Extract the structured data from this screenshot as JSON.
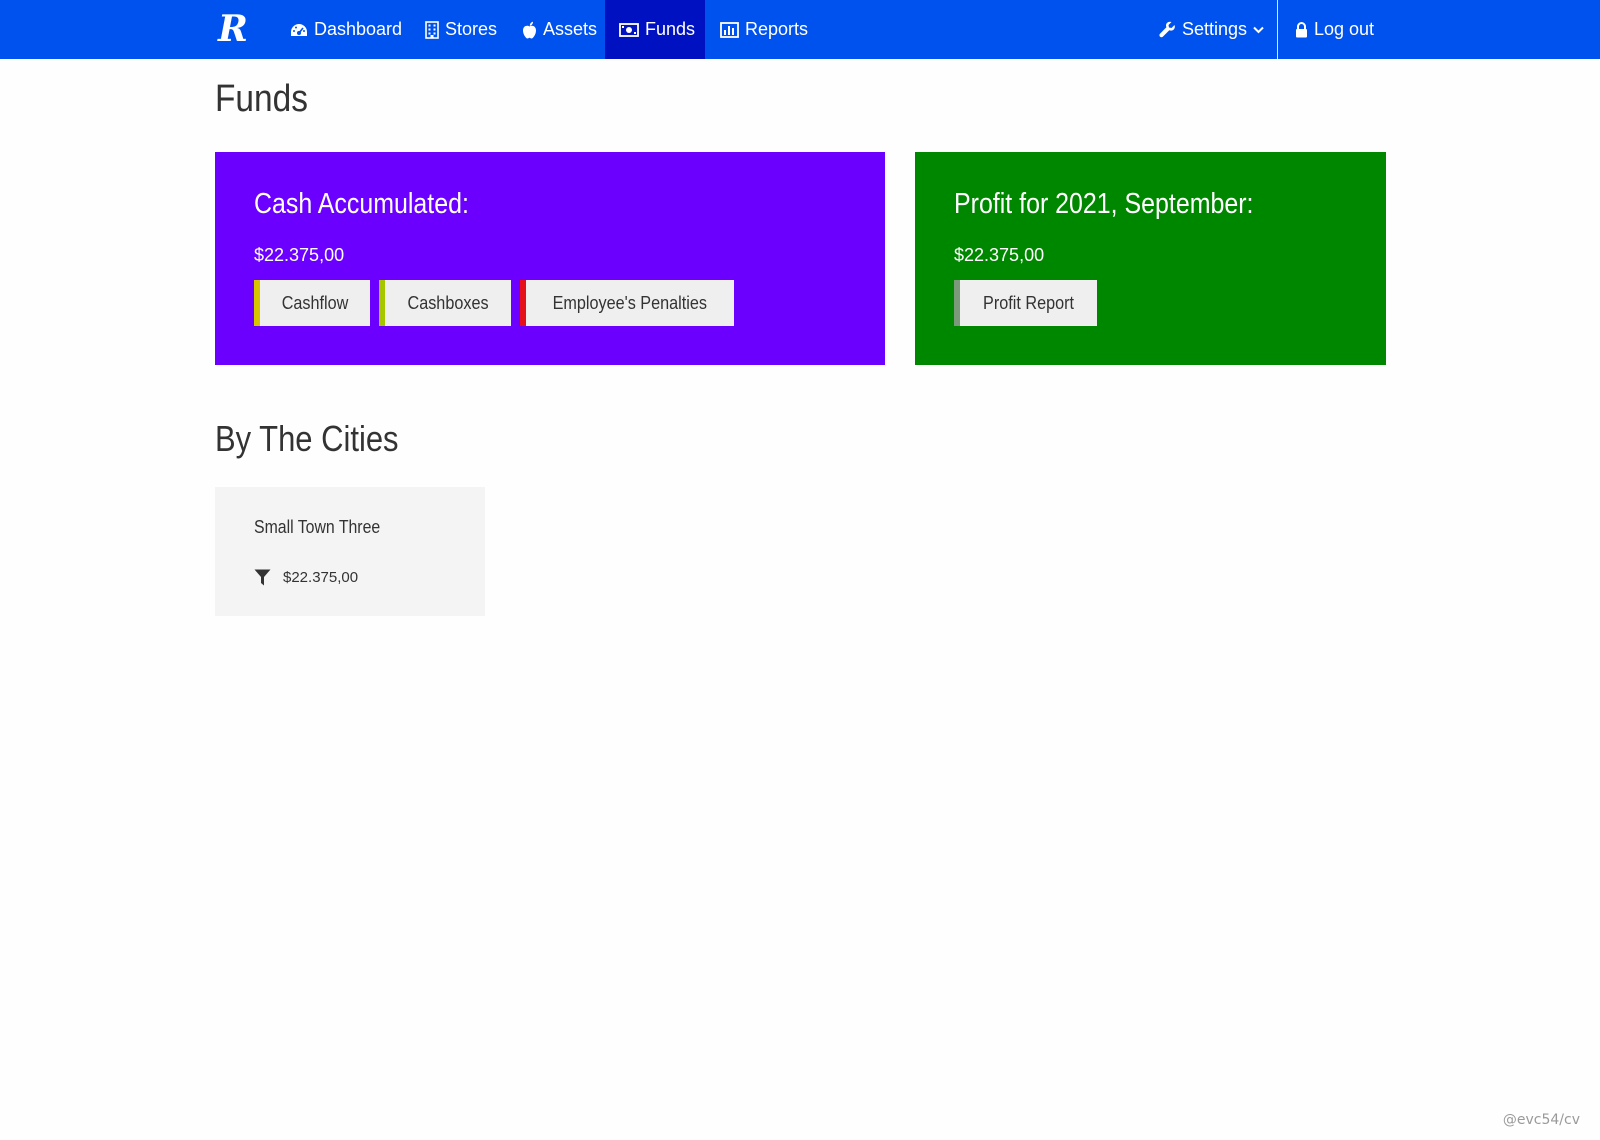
{
  "navbar": {
    "brand": "R",
    "items": [
      {
        "label": "Dashboard",
        "icon": "tachometer-icon",
        "active": false
      },
      {
        "label": "Stores",
        "icon": "building-icon",
        "active": false
      },
      {
        "label": "Assets",
        "icon": "apple-icon",
        "active": false
      },
      {
        "label": "Funds",
        "icon": "money-icon",
        "active": true
      },
      {
        "label": "Reports",
        "icon": "bar-chart-icon",
        "active": false
      }
    ],
    "settings": {
      "label": "Settings",
      "icon": "wrench-icon"
    },
    "logout": {
      "label": "Log out",
      "icon": "lock-icon"
    },
    "color": "#0052ef",
    "active_color": "#0011c2"
  },
  "page": {
    "title": "Funds"
  },
  "cash_panel": {
    "heading": "Cash Accumulated:",
    "amount": "$22.375,00",
    "color": "#6c00ff",
    "buttons": [
      {
        "label": "Cashflow",
        "accent": "#d8c400"
      },
      {
        "label": "Cashboxes",
        "accent": "#a6c700"
      },
      {
        "label": "Employee's Penalties",
        "accent": "#e6101a"
      }
    ]
  },
  "profit_panel": {
    "heading": "Profit for 2021, September:",
    "amount": "$22.375,00",
    "color": "#008700",
    "buttons": [
      {
        "label": "Profit Report",
        "accent": "#7a9a7a"
      }
    ]
  },
  "cities_section": {
    "title": "By The Cities",
    "cities": [
      {
        "name": "Small Town Three",
        "amount": "$22.375,00",
        "icon": "filter-icon"
      }
    ]
  },
  "watermark": "@evc54/cv"
}
